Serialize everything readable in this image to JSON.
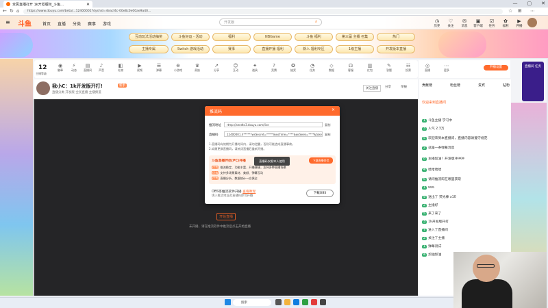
{
  "browser": {
    "tab_title": "全民直播打开 1k开发版权_斗鱼...",
    "url": "https://www.douyu.com/beta/...12400001?dyshid=4eacf4c-00e6c0e00ae9a40...",
    "window_controls": [
      "—",
      "▢",
      "✕"
    ]
  },
  "site": {
    "logo": "斗鱼",
    "nav": [
      "首页",
      "直播",
      "分类",
      "赛事",
      "游戏"
    ],
    "search_placeholder": "开发版",
    "header_icons": [
      {
        "icon": "history-icon",
        "label": "历史"
      },
      {
        "icon": "follow-icon",
        "label": "关注"
      },
      {
        "icon": "message-icon",
        "label": "消息"
      },
      {
        "icon": "app-icon",
        "label": "客户端"
      },
      {
        "icon": "task-icon",
        "label": "任务"
      },
      {
        "icon": "gift-icon",
        "label": "福利"
      },
      {
        "icon": "live-icon",
        "label": "开播"
      }
    ]
  },
  "banner_tags_row1": [
    "互动玩法活动抽奖",
    "斗鱼好运 - 活动",
    "福利",
    "NBGame",
    "斗鱼 福利",
    "第三届 主播 召集",
    "热门"
  ],
  "banner_tags_row2": [
    "主播专属",
    "Switch 游戏活动",
    "赛事",
    "直播开播 福利",
    "新人 福利专区",
    "1级主播",
    "开发版本直播"
  ],
  "toolbar": {
    "rank_num": "12",
    "rank_label": "主播等级",
    "tools": [
      "徽章",
      "动态",
      "直播间",
      "声音",
      "礼物",
      "视频",
      "弹幕",
      "小游戏",
      "贵族",
      "分享",
      "互动",
      "道具",
      "竞猜",
      "抽奖",
      "任务",
      "数据",
      "客服",
      "红包",
      "答题",
      "投票",
      "粉丝",
      "外卖",
      "推流",
      "直播",
      "更多"
    ],
    "right_btn": "开播设置"
  },
  "room": {
    "title": "我小C：1k开发版开打!",
    "tag": "新手",
    "subinfo": "直播分类  开发版  全民直播  主播频道",
    "right_actions": [
      "关注直播",
      "分享",
      "举报"
    ]
  },
  "modal": {
    "title": "推流码",
    "close": "×",
    "server_label": "推流地址",
    "server_value": "rtmp://sendtc3.douyu.com/live",
    "server_copy": "复制",
    "key_label": "直播码",
    "key_value": "12400001.rl*****?wsSecret=*****&wsTime=****&wsSeek=****&token=....",
    "key_copy": "复制",
    "note1": "1.直播码有效期为开播时间内，请勿泄露，否则可能造成直播事故。",
    "note2": "2.如需更换直播码，请关闭直播后重新开播。",
    "promo_title": "斗鱼直播伴侣(PC)开播",
    "promo_button": "下载直播伴侣",
    "promo_lines": [
      {
        "k": "优势",
        "t": "推流稳定、功能丰富、开播便捷，支持多种直播场景"
      },
      {
        "k": "优势",
        "t": "支持多场景素材、美颜、弹幕互动"
      },
      {
        "k": "优势",
        "t": "直播分析、数据统计一应俱全"
      }
    ],
    "tooltip": "直播码仅限本人使用",
    "low_title": "OBS等推流软件开播",
    "low_link": "查看教程",
    "low_sub": "填入推流地址及直播码即可开播",
    "low_button": "下载OBS"
  },
  "player": {
    "start_button": "开始直播",
    "tip": "未开播，请在推流软件中推流后点击开始直播"
  },
  "chat": {
    "tabs": [
      "贡献榜",
      "粉丝榜",
      "贵宾",
      "钻粉"
    ],
    "notice": "欢迎来到直播间",
    "lines": [
      {
        "lv": "1",
        "t": "斗鱼主播 学习中"
      },
      {
        "lv": "3",
        "t": "人气 2.3万"
      },
      {
        "lv": "5",
        "t": "欢迎来到本直播间，直播内容请遵守规范"
      },
      {
        "lv": "2",
        "t": "这是一条弹幕消息"
      },
      {
        "lv": "8",
        "t": "主播加油！开发版冲冲冲"
      },
      {
        "lv": "4",
        "t": "哈哈哈哈"
      },
      {
        "lv": "6",
        "t": "请问推流码在哪里获取"
      },
      {
        "lv": "1",
        "t": "666"
      },
      {
        "lv": "9",
        "t": "送出了 荧光棒 x10"
      },
      {
        "lv": "2",
        "t": "主播好"
      },
      {
        "lv": "5",
        "t": "来了来了"
      },
      {
        "lv": "3",
        "t": "1k开发版开打"
      },
      {
        "lv": "7",
        "t": "进入了直播间"
      },
      {
        "lv": "2",
        "t": "关注了主播"
      },
      {
        "lv": "1",
        "t": "弹幕测试"
      },
      {
        "lv": "4",
        "t": "加油加油"
      }
    ]
  },
  "right_sidebar": {
    "label": "直播间 任务"
  },
  "taskbar": {
    "search": "搜索"
  }
}
